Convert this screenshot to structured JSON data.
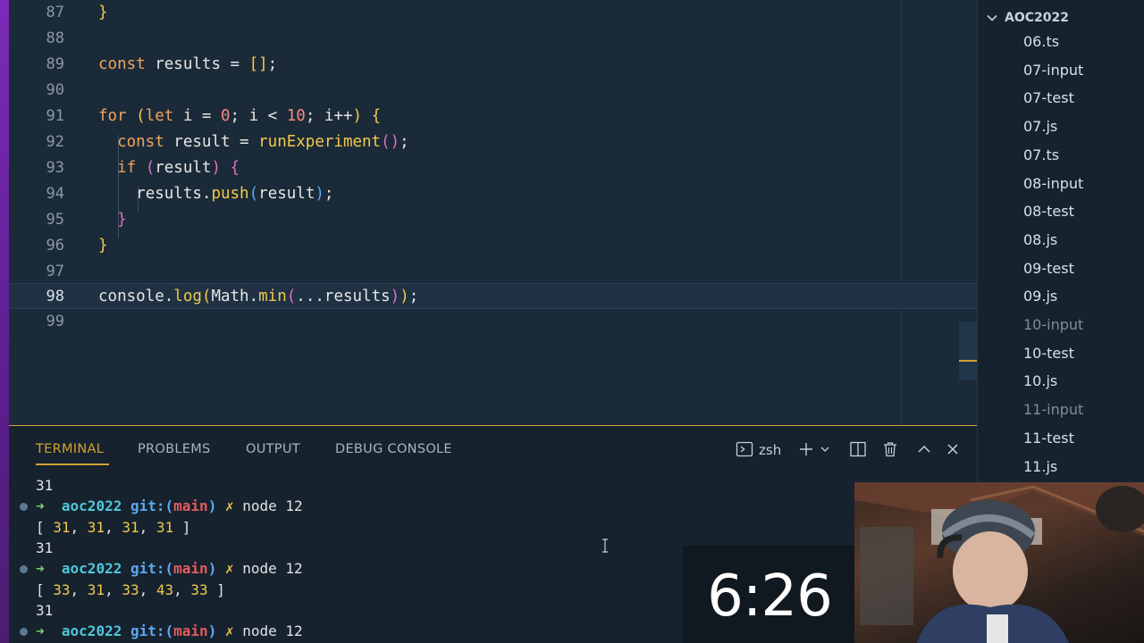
{
  "editor": {
    "lines": [
      {
        "num": "87",
        "code": "}"
      },
      {
        "num": "88",
        "code": ""
      },
      {
        "num": "89",
        "code": "const results = [];"
      },
      {
        "num": "90",
        "code": ""
      },
      {
        "num": "91",
        "code": "for (let i = 0; i < 10; i++) {"
      },
      {
        "num": "92",
        "code": "  const result = runExperiment();"
      },
      {
        "num": "93",
        "code": "  if (result) {"
      },
      {
        "num": "94",
        "code": "    results.push(result);"
      },
      {
        "num": "95",
        "code": "  }"
      },
      {
        "num": "96",
        "code": "}"
      },
      {
        "num": "97",
        "code": ""
      },
      {
        "num": "98",
        "code": "console.log(Math.min(...results));"
      },
      {
        "num": "99",
        "code": ""
      }
    ],
    "tokens": {
      "l87_brace": "}",
      "l89_const": "const",
      "l89_rest": " results = ",
      "l89_arr": "[]",
      "l89_semi": ";",
      "l91_for": "for",
      "l91_open": " (",
      "l91_let": "let",
      "l91_a": " i = ",
      "l91_zero": "0",
      "l91_b": "; i < ",
      "l91_ten": "10",
      "l91_c": "; i++",
      "l91_close": ")",
      "l91_brace": " {",
      "l92_const": "const",
      "l92_a": " result = ",
      "l92_fn": "runExperiment",
      "l92_paren": "()",
      "l92_semi": ";",
      "l93_if": "if",
      "l93_open": " (",
      "l93_a": "result",
      "l93_close": ")",
      "l93_brace": " {",
      "l94_a": "results.",
      "l94_fn": "push",
      "l94_open": "(",
      "l94_b": "result",
      "l94_close": ")",
      "l94_semi": ";",
      "l95_brace": "}",
      "l96_brace": "}",
      "l98_a": "console.",
      "l98_log": "log",
      "l98_open1": "(",
      "l98_b": "Math.",
      "l98_min": "min",
      "l98_open2": "(",
      "l98_c": "...results",
      "l98_close2": ")",
      "l98_close1": ")",
      "l98_semi": ";"
    }
  },
  "explorer": {
    "folder": "AOC2022",
    "files": [
      {
        "name": "06.ts",
        "dim": false
      },
      {
        "name": "07-input",
        "dim": false
      },
      {
        "name": "07-test",
        "dim": false
      },
      {
        "name": "07.js",
        "dim": false
      },
      {
        "name": "07.ts",
        "dim": false
      },
      {
        "name": "08-input",
        "dim": false
      },
      {
        "name": "08-test",
        "dim": false
      },
      {
        "name": "08.js",
        "dim": false
      },
      {
        "name": "09-test",
        "dim": false
      },
      {
        "name": "09.js",
        "dim": false
      },
      {
        "name": "10-input",
        "dim": true
      },
      {
        "name": "10-test",
        "dim": false
      },
      {
        "name": "10.js",
        "dim": false
      },
      {
        "name": "11-input",
        "dim": true
      },
      {
        "name": "11-test",
        "dim": false
      },
      {
        "name": "11.js",
        "dim": false
      }
    ]
  },
  "panel": {
    "tabs": [
      "TERMINAL",
      "PROBLEMS",
      "OUTPUT",
      "DEBUG CONSOLE"
    ],
    "shell": "zsh"
  },
  "terminal": {
    "out1": "31",
    "prompt_dir": "aoc2022",
    "prompt_git": "git:",
    "prompt_open": "(",
    "prompt_branch": "main",
    "prompt_close": ")",
    "prompt_cross": "✗",
    "prompt_arrow": "➜",
    "command": "node 12",
    "arr1_open": "[ ",
    "arr1_values": [
      "31",
      "31",
      "31",
      "31"
    ],
    "arr1_close": " ]",
    "out2": "31",
    "arr2_open": "[ ",
    "arr2_values": [
      "33",
      "31",
      "33",
      "43",
      "33"
    ],
    "arr2_close": " ]",
    "out3": "31"
  },
  "timer": "6:26",
  "colors": {
    "accent": "#d2a233",
    "editor_bg": "#1b2a38",
    "panel_bg": "#16222e",
    "keyword": "#f0a45d",
    "function": "#f2c94c",
    "number": "#f28b82"
  }
}
